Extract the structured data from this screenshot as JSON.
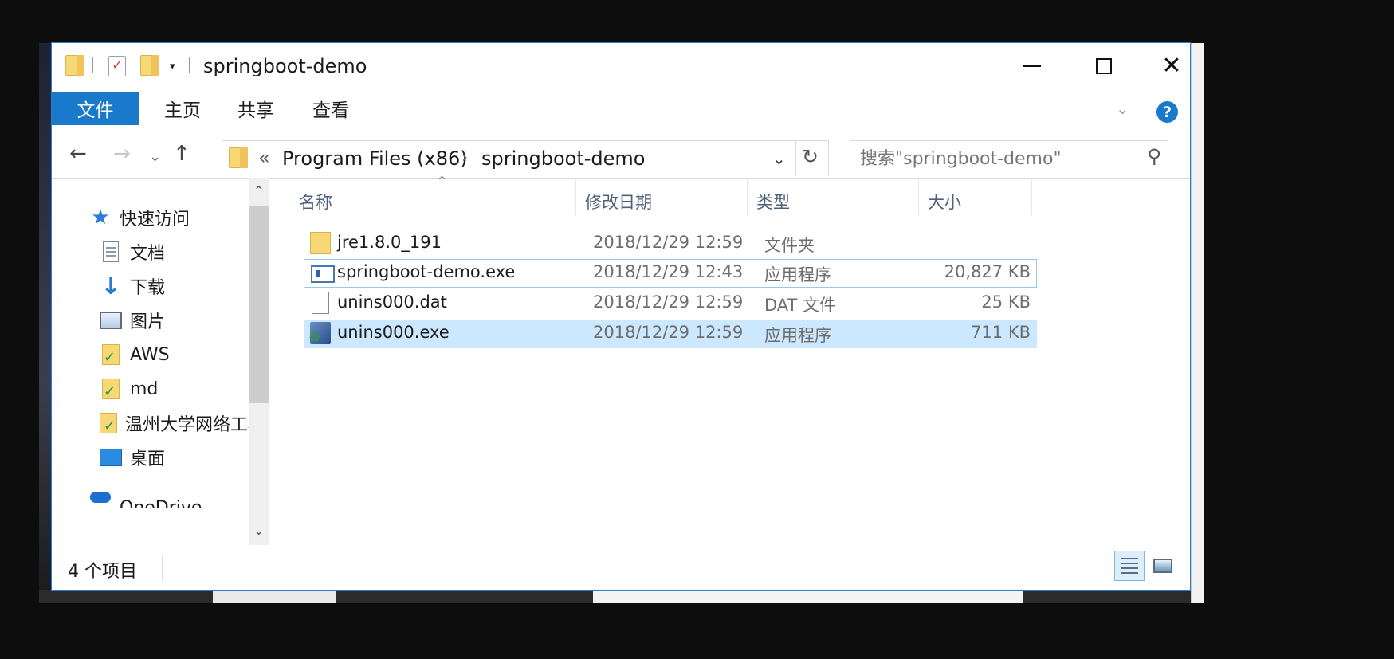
{
  "window": {
    "title": "springboot-demo"
  },
  "ribbon": {
    "tabs": [
      {
        "label": "文件"
      },
      {
        "label": "主页"
      },
      {
        "label": "共享"
      },
      {
        "label": "查看"
      }
    ],
    "help_label": "?"
  },
  "address_bar": {
    "overflow": "«",
    "crumbs": [
      "Program Files (x86)",
      "springboot-demo"
    ],
    "separator": "›"
  },
  "search": {
    "placeholder": "搜索\"springboot-demo\""
  },
  "nav_pane": {
    "quick_access": "快速访问",
    "items": [
      {
        "label": "文档",
        "icon": "document-icon",
        "pinned": true
      },
      {
        "label": "下载",
        "icon": "download-icon",
        "pinned": true
      },
      {
        "label": "图片",
        "icon": "pictures-icon",
        "pinned": true
      },
      {
        "label": "AWS",
        "icon": "synced-folder-icon"
      },
      {
        "label": "md",
        "icon": "synced-folder-icon"
      },
      {
        "label": "温州大学网络工程",
        "icon": "synced-folder-icon"
      },
      {
        "label": "桌面",
        "icon": "desktop-icon"
      },
      {
        "label": "OneDrive",
        "icon": "onedrive-icon"
      }
    ]
  },
  "file_list": {
    "columns": [
      "名称",
      "修改日期",
      "类型",
      "大小"
    ],
    "rows": [
      {
        "name": "jre1.8.0_191",
        "modified": "2018/12/29 12:59",
        "type": "文件夹",
        "size": "",
        "icon": "folder-icon"
      },
      {
        "name": "springboot-demo.exe",
        "modified": "2018/12/29 12:43",
        "type": "应用程序",
        "size": "20,827 KB",
        "icon": "exe-icon"
      },
      {
        "name": "unins000.dat",
        "modified": "2018/12/29 12:59",
        "type": "DAT 文件",
        "size": "25 KB",
        "icon": "file-icon"
      },
      {
        "name": "unins000.exe",
        "modified": "2018/12/29 12:59",
        "type": "应用程序",
        "size": "711 KB",
        "icon": "uninstaller-icon"
      }
    ]
  },
  "status_bar": {
    "item_count": "4 个项目"
  },
  "colors": {
    "accent": "#1979ca",
    "selection": "#cce8ff",
    "focus_border": "#99c9ef"
  }
}
